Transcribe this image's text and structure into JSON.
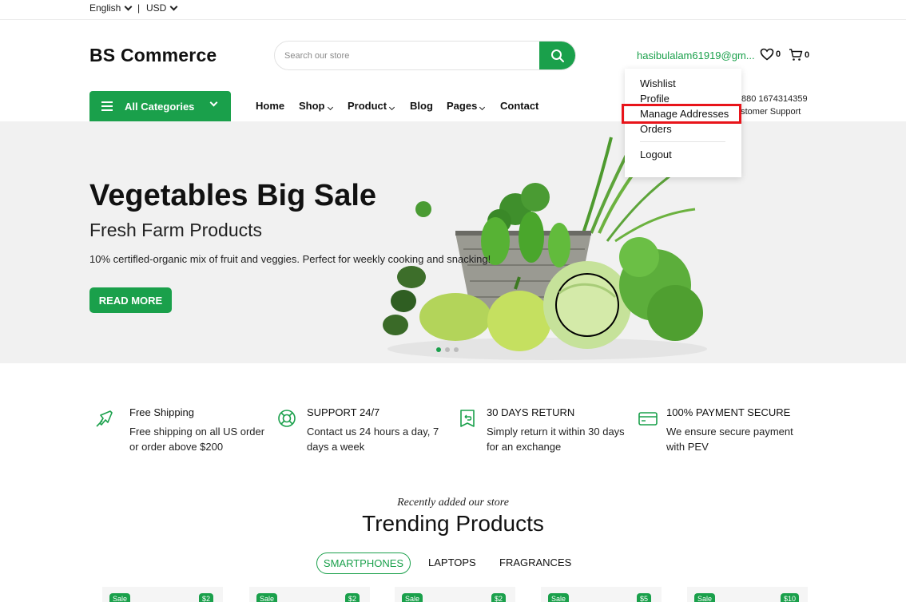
{
  "topbar": {
    "language": "English",
    "currency": "USD",
    "separator": "|"
  },
  "header": {
    "logo": "BS Commerce",
    "search_placeholder": "Search our store",
    "account": "hasibulalam61919@gm...",
    "wishlist_count": "0",
    "cart_count": "0"
  },
  "nav": {
    "all_categories": "All Categories",
    "items": [
      "Home",
      "Shop",
      "Product",
      "Blog",
      "Pages",
      "Contact"
    ],
    "phone": "880 1674314359",
    "support": "ustomer Support"
  },
  "dropdown": {
    "items": [
      "Wishlist",
      "Profile",
      "Manage Addresses",
      "Orders",
      "Logout"
    ],
    "highlighted": "Manage Addresses"
  },
  "hero": {
    "title": "Vegetables Big Sale",
    "subtitle": "Fresh Farm Products",
    "description": "10% certifled-organic mix of fruit and veggies. Perfect for weekly cooking and snacking!",
    "button": "READ MORE",
    "slide_count": 3,
    "active_slide": 0
  },
  "features": [
    {
      "title": "Free Shipping",
      "desc": "Free shipping on all US order or order above $200",
      "icon": "plane-icon"
    },
    {
      "title": "SUPPORT 24/7",
      "desc": "Contact us 24 hours a day, 7 days a week",
      "icon": "lifebuoy-icon"
    },
    {
      "title": "30 DAYS RETURN",
      "desc": "Simply return it within 30 days for an exchange",
      "icon": "return-icon"
    },
    {
      "title": "100% PAYMENT SECURE",
      "desc": "We ensure secure payment with PEV",
      "icon": "credit-card-icon"
    }
  ],
  "trending": {
    "kicker": "Recently added our store",
    "title": "Trending Products",
    "tabs": [
      "SMARTPHONES",
      "LAPTOPS",
      "FRAGRANCES"
    ],
    "active_tab": "SMARTPHONES",
    "cards": [
      {
        "sale": "Sale",
        "price": "$2"
      },
      {
        "sale": "Sale",
        "price": "$2"
      },
      {
        "sale": "Sale",
        "price": "$2"
      },
      {
        "sale": "Sale",
        "price": "$5"
      },
      {
        "sale": "Sale",
        "price": "$10"
      }
    ]
  },
  "colors": {
    "brand": "#1aa04b",
    "highlight": "#e8141a",
    "hero_bg": "#f1f1f1"
  }
}
